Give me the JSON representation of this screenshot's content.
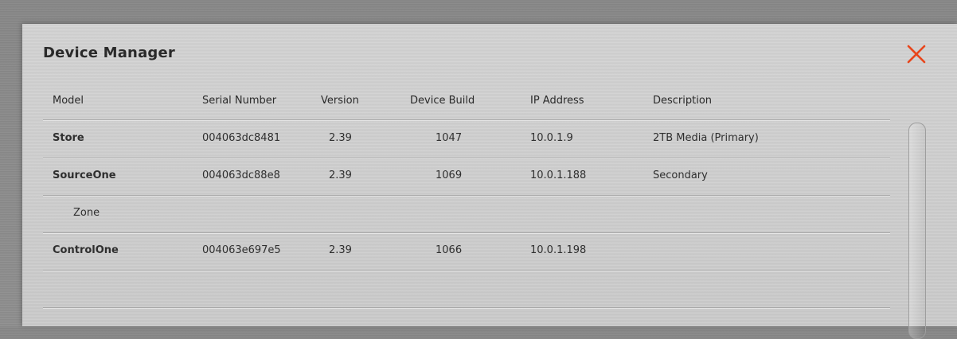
{
  "dialog": {
    "title": "Device Manager",
    "close_icon": "close-x-icon",
    "accent_color": "#e8461c"
  },
  "table": {
    "headers": {
      "model": "Model",
      "serial": "Serial Number",
      "version": "Version",
      "build": "Device Build",
      "ip": "IP Address",
      "description": "Description"
    },
    "rows": [
      {
        "model": "Store",
        "serial": "004063dc8481",
        "version": "2.39",
        "build": "1047",
        "ip": "10.0.1.9",
        "description": "2TB Media (Primary)"
      },
      {
        "model": "SourceOne",
        "serial": "004063dc88e8",
        "version": "2.39",
        "build": "1069",
        "ip": "10.0.1.188",
        "description": "Secondary"
      },
      {
        "model": "Zone",
        "serial": "",
        "version": "",
        "build": "",
        "ip": "",
        "description": ""
      },
      {
        "model": "ControlOne",
        "serial": "004063e697e5",
        "version": "2.39",
        "build": "1066",
        "ip": "10.0.1.198",
        "description": ""
      },
      {
        "model": "",
        "serial": "",
        "version": "",
        "build": "",
        "ip": "",
        "description": ""
      }
    ]
  }
}
